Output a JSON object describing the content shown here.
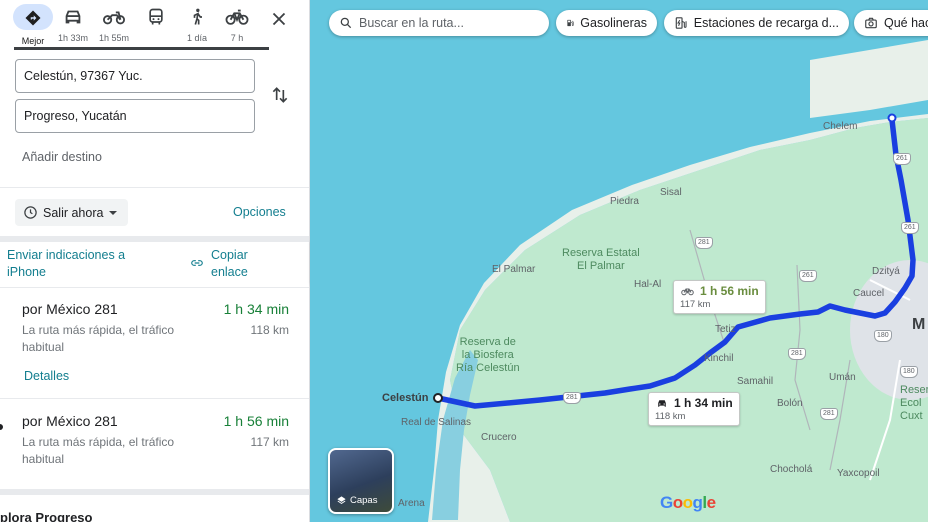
{
  "travel_modes": [
    {
      "name": "Mejor",
      "time": "Mejor",
      "icon": "directions-icon",
      "active": true
    },
    {
      "name": "car",
      "time": "1h 33m",
      "icon": "car-icon"
    },
    {
      "name": "motorcycle",
      "time": "1h 55m",
      "icon": "motorcycle-icon"
    },
    {
      "name": "transit",
      "time": "",
      "icon": "bus-icon"
    },
    {
      "name": "walk",
      "time": "1 día",
      "icon": "walk-icon"
    },
    {
      "name": "bike",
      "time": "7 h",
      "icon": "bicycle-icon"
    }
  ],
  "origin": "Celestún, 97367 Yuc.",
  "destination": "Progreso, Yucatán",
  "add_destination": "Añadir destino",
  "depart_label": "Salir ahora",
  "options_label": "Opciones",
  "send_label": "Enviar indicaciones a iPhone",
  "copy_label": "Copiar enlace",
  "routes": [
    {
      "name": "por México 281",
      "time": "1 h 34 min",
      "desc": "La ruta más rápida, el tráfico habitual",
      "dist": "118 km",
      "details": "Detalles"
    },
    {
      "name": "por México 281",
      "time": "1 h 56 min",
      "desc": "La ruta más rápida, el tráfico habitual",
      "dist": "117 km"
    }
  ],
  "explore_label": "plora Progreso",
  "map": {
    "search_placeholder": "Buscar en la ruta...",
    "chips": [
      "Gasolineras",
      "Estaciones de recarga d...",
      "Qué hac"
    ],
    "labels": {
      "chelem": "Chelem",
      "piedra": "Piedra",
      "sisal": "Sisal",
      "reserva_elpalmar": "Reserva Estatal\nEl Palmar",
      "el_palmar": "El Palmar",
      "hal_al": "Hal-Al",
      "dzitya": "Dzityá",
      "caucel": "Caucel",
      "tetiz": "Tetiz",
      "kinchil": "Kinchil",
      "reserva_celestun": "Reserva de\nla Biosfera\nRía Celestún",
      "celestun": "Celestún",
      "samahil": "Samahil",
      "uman": "Umán",
      "real_salinas": "Real de Salinas",
      "crucero": "Crucero",
      "bolon": "Bolón",
      "reserva_ecol": "Reserva\nEcol\nCuxt",
      "chochola": "Chocholá",
      "yaxcopoil": "Yaxcopoil",
      "arena": "Arena",
      "merida": "M"
    },
    "shields": [
      "261",
      "261",
      "261",
      "281",
      "281",
      "281",
      "281",
      "180",
      "180"
    ],
    "callout_main": {
      "time": "1 h 34 min",
      "dist": "118 km"
    },
    "callout_alt": {
      "time": "1 h 56 min",
      "dist": "117 km"
    },
    "layers_label": "Capas",
    "google": "Google",
    "colors": {
      "route": "#1a3fe0",
      "sea": "#64c7df",
      "land": "#bfe9cf"
    }
  }
}
